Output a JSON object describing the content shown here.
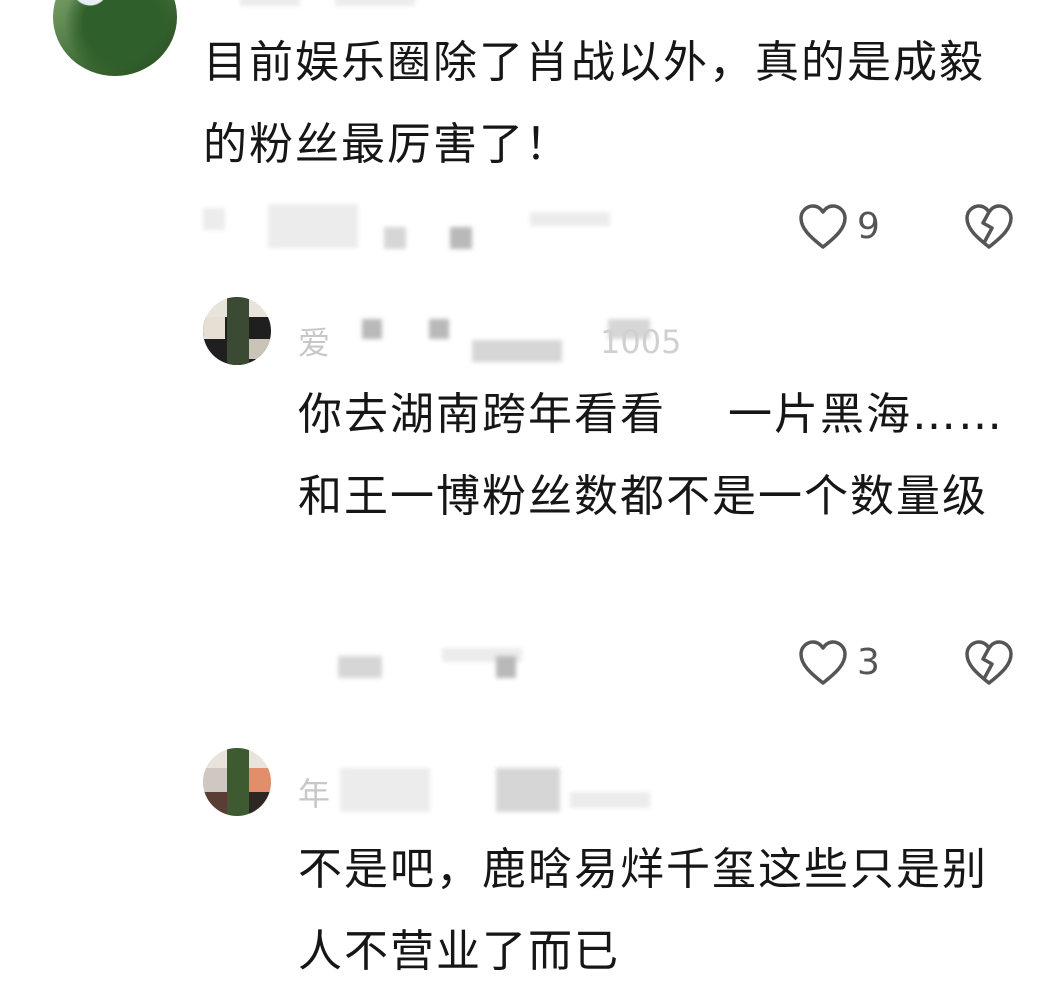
{
  "comments": [
    {
      "author_fragment": "",
      "text": "目前娱乐圈除了肖战以外，真的是成毅的粉丝最厉害了！",
      "time_fragment": "",
      "like_count": "9",
      "icons": {
        "like": "heart-outline-icon",
        "dislike": "broken-heart-icon"
      }
    },
    {
      "author_fragment": "爱",
      "author_tail": "1005",
      "text": "你去湖南跨年看看　 一片黑海……和王一博粉丝数都不是一个数量级",
      "time_fragment": "",
      "like_count": "3",
      "icons": {
        "like": "heart-outline-icon",
        "dislike": "broken-heart-icon"
      }
    },
    {
      "author_fragment": "年",
      "text": "不是吧，鹿晗易烊千玺这些只是别人不营业了而已",
      "icons": {
        "like": "heart-outline-icon",
        "dislike": "broken-heart-icon"
      }
    }
  ],
  "colors": {
    "text": "#161616",
    "icon": "#555555",
    "blur": "#d6d6d6"
  }
}
